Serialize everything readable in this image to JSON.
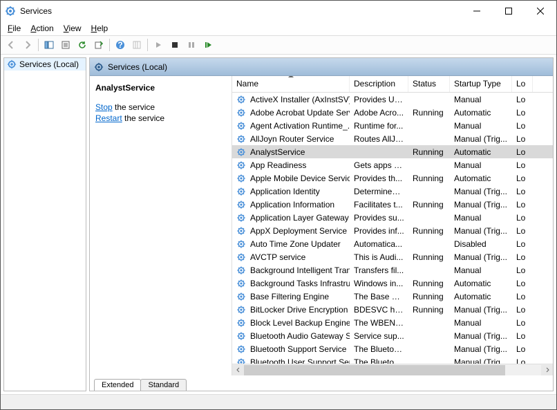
{
  "window": {
    "title": "Services"
  },
  "menu": {
    "file": "File",
    "action": "Action",
    "view": "View",
    "help": "Help"
  },
  "tree": {
    "root": "Services (Local)"
  },
  "panel": {
    "header": "Services (Local)"
  },
  "detail": {
    "selected": "AnalystService",
    "stop_label": "Stop",
    "stop_suffix": " the service",
    "restart_label": "Restart",
    "restart_suffix": " the service"
  },
  "columns": {
    "name": "Name",
    "description": "Description",
    "status": "Status",
    "startup": "Startup Type",
    "logon": "Lo"
  },
  "tabs": {
    "extended": "Extended",
    "standard": "Standard"
  },
  "services": [
    {
      "name": "ActiveX Installer (AxInstSV)",
      "desc": "Provides Us...",
      "status": "",
      "startup": "Manual",
      "log": "Lo",
      "sel": false
    },
    {
      "name": "Adobe Acrobat Update Serv...",
      "desc": "Adobe Acro...",
      "status": "Running",
      "startup": "Automatic",
      "log": "Lo",
      "sel": false
    },
    {
      "name": "Agent Activation Runtime_...",
      "desc": "Runtime for...",
      "status": "",
      "startup": "Manual",
      "log": "Lo",
      "sel": false
    },
    {
      "name": "AllJoyn Router Service",
      "desc": "Routes AllJo...",
      "status": "",
      "startup": "Manual (Trig...",
      "log": "Lo",
      "sel": false
    },
    {
      "name": "AnalystService",
      "desc": "",
      "status": "Running",
      "startup": "Automatic",
      "log": "Lo",
      "sel": true
    },
    {
      "name": "App Readiness",
      "desc": "Gets apps re...",
      "status": "",
      "startup": "Manual",
      "log": "Lo",
      "sel": false
    },
    {
      "name": "Apple Mobile Device Service",
      "desc": "Provides th...",
      "status": "Running",
      "startup": "Automatic",
      "log": "Lo",
      "sel": false
    },
    {
      "name": "Application Identity",
      "desc": "Determines ...",
      "status": "",
      "startup": "Manual (Trig...",
      "log": "Lo",
      "sel": false
    },
    {
      "name": "Application Information",
      "desc": "Facilitates t...",
      "status": "Running",
      "startup": "Manual (Trig...",
      "log": "Lo",
      "sel": false
    },
    {
      "name": "Application Layer Gateway ...",
      "desc": "Provides su...",
      "status": "",
      "startup": "Manual",
      "log": "Lo",
      "sel": false
    },
    {
      "name": "AppX Deployment Service (...",
      "desc": "Provides inf...",
      "status": "Running",
      "startup": "Manual (Trig...",
      "log": "Lo",
      "sel": false
    },
    {
      "name": "Auto Time Zone Updater",
      "desc": "Automatica...",
      "status": "",
      "startup": "Disabled",
      "log": "Lo",
      "sel": false
    },
    {
      "name": "AVCTP service",
      "desc": "This is Audi...",
      "status": "Running",
      "startup": "Manual (Trig...",
      "log": "Lo",
      "sel": false
    },
    {
      "name": "Background Intelligent Tran...",
      "desc": "Transfers fil...",
      "status": "",
      "startup": "Manual",
      "log": "Lo",
      "sel": false
    },
    {
      "name": "Background Tasks Infrastruc...",
      "desc": "Windows in...",
      "status": "Running",
      "startup": "Automatic",
      "log": "Lo",
      "sel": false
    },
    {
      "name": "Base Filtering Engine",
      "desc": "The Base Fil...",
      "status": "Running",
      "startup": "Automatic",
      "log": "Lo",
      "sel": false
    },
    {
      "name": "BitLocker Drive Encryption ...",
      "desc": "BDESVC hos...",
      "status": "Running",
      "startup": "Manual (Trig...",
      "log": "Lo",
      "sel": false
    },
    {
      "name": "Block Level Backup Engine ...",
      "desc": "The WBENG...",
      "status": "",
      "startup": "Manual",
      "log": "Lo",
      "sel": false
    },
    {
      "name": "Bluetooth Audio Gateway S...",
      "desc": "Service sup...",
      "status": "",
      "startup": "Manual (Trig...",
      "log": "Lo",
      "sel": false
    },
    {
      "name": "Bluetooth Support Service",
      "desc": "The Bluetoo...",
      "status": "",
      "startup": "Manual (Trig...",
      "log": "Lo",
      "sel": false
    },
    {
      "name": "Bluetooth User Support Ser...",
      "desc": "The Blueto...",
      "status": "",
      "startup": "Manual (Trig...",
      "log": "Lo",
      "sel": false
    }
  ]
}
